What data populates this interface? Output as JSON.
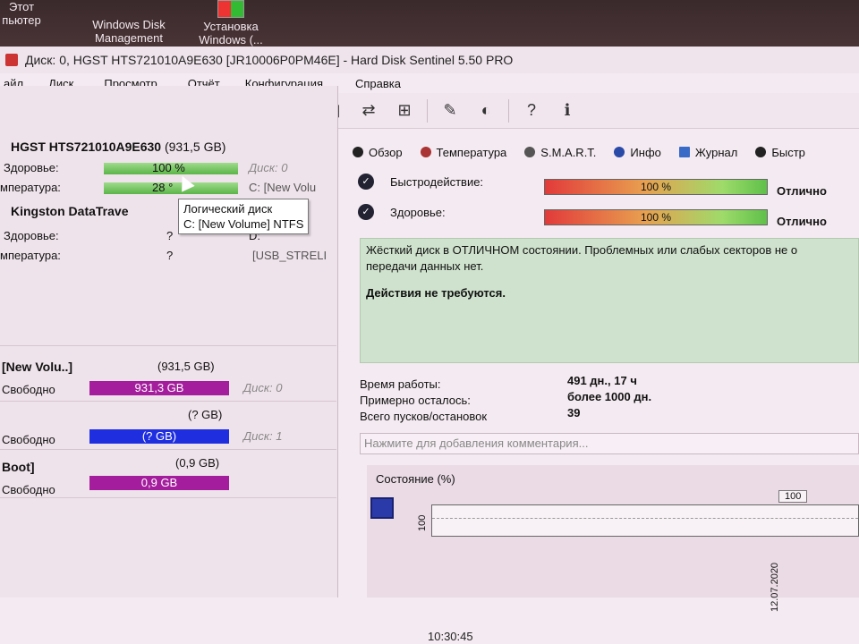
{
  "desktop": {
    "icons": [
      {
        "label1": "Этот",
        "label2": "пьютер",
        "icon": "computer-icon"
      },
      {
        "label1": "Windows Disk",
        "label2": "Management",
        "icon": "disk-management-icon"
      },
      {
        "label1": "Установка",
        "label2": "Windows (...",
        "icon": "windows-setup-icon"
      }
    ]
  },
  "window": {
    "title": "Диск: 0, HGST HTS721010A9E630 [JR10006P0PM46E]  -  Hard Disk Sentinel 5.50 PRO"
  },
  "menu": [
    "айл",
    "Диск",
    "Просмотр",
    "Отчёт",
    "Конфигурация",
    "Справка"
  ],
  "disks": [
    {
      "name": "HGST HTS721010A9E630",
      "size": "(931,5 GB)",
      "health_label": "Здоровье:",
      "health_value": "100 %",
      "health_pct": 100,
      "health_disk": "Диск: 0",
      "temp_label": "мпература:",
      "temp_value": "28 °",
      "temp_disk": "C: [New Volu"
    },
    {
      "name": "Kingston DataTrave",
      "health_label": "Здоровье:",
      "health_value": "?",
      "health_disk": "D:",
      "temp_label": "мпература:",
      "temp_value": "?",
      "temp_disk": "[USB_STRELI"
    }
  ],
  "tooltip": {
    "line1": "Логический диск",
    "line2": "C: [New Volume] NTFS"
  },
  "volumes": [
    {
      "name": "[New Volu..]",
      "size": "(931,5 GB)",
      "free_label": "Свободно",
      "free_value": "931,3 GB",
      "disk": "Диск: 0",
      "color": "#a41d9d"
    },
    {
      "name": "",
      "size": "(? GB)",
      "free_label": "Свободно",
      "free_value": "(? GB)",
      "disk": "Диск: 1",
      "color": "#1f2fe0"
    },
    {
      "name": "Boot]",
      "size": "(0,9 GB)",
      "free_label": "Свободно",
      "free_value": "0,9 GB",
      "disk": "",
      "color": "#a41d9d"
    }
  ],
  "tabs": [
    {
      "label": "Обзор",
      "icon": "overview-icon"
    },
    {
      "label": "Температура",
      "icon": "thermometer-icon"
    },
    {
      "label": "S.M.A.R.T.",
      "icon": "smart-icon"
    },
    {
      "label": "Инфо",
      "icon": "info-icon"
    },
    {
      "label": "Журнал",
      "icon": "log-icon"
    },
    {
      "label": "Быстр",
      "icon": "speed-icon"
    }
  ],
  "status": {
    "performance_label": "Быстродействие:",
    "performance_value": "100 %",
    "performance_pct": 100,
    "performance_word": "Отлично",
    "health_label": "Здоровье:",
    "health_value": "100 %",
    "health_pct": 100,
    "health_word": "Отлично"
  },
  "message": {
    "line1": "Жёсткий диск в ОТЛИЧНОМ состоянии. Проблемных или слабых секторов не о",
    "line2": "передачи данных нет.",
    "action": "Действия не требуются."
  },
  "stats": {
    "uptime_label": "Время работы:",
    "uptime_value": "491 дн., 17 ч",
    "remaining_label": "Примерно осталось:",
    "remaining_value": "более 1000 дн.",
    "starts_label": "Всего пусков/остановок",
    "starts_value": "39"
  },
  "comment_placeholder": "Нажмите для добавления комментария...",
  "chart": {
    "title": "Состояние (%)",
    "y_tick": "100",
    "point_label": "100",
    "date": "12.07.2020"
  },
  "chart_data": {
    "type": "line",
    "title": "Состояние (%)",
    "x": [
      "12.07.2020"
    ],
    "values": [
      100
    ],
    "ylim": [
      0,
      100
    ]
  },
  "footer_time": "10:30:45"
}
